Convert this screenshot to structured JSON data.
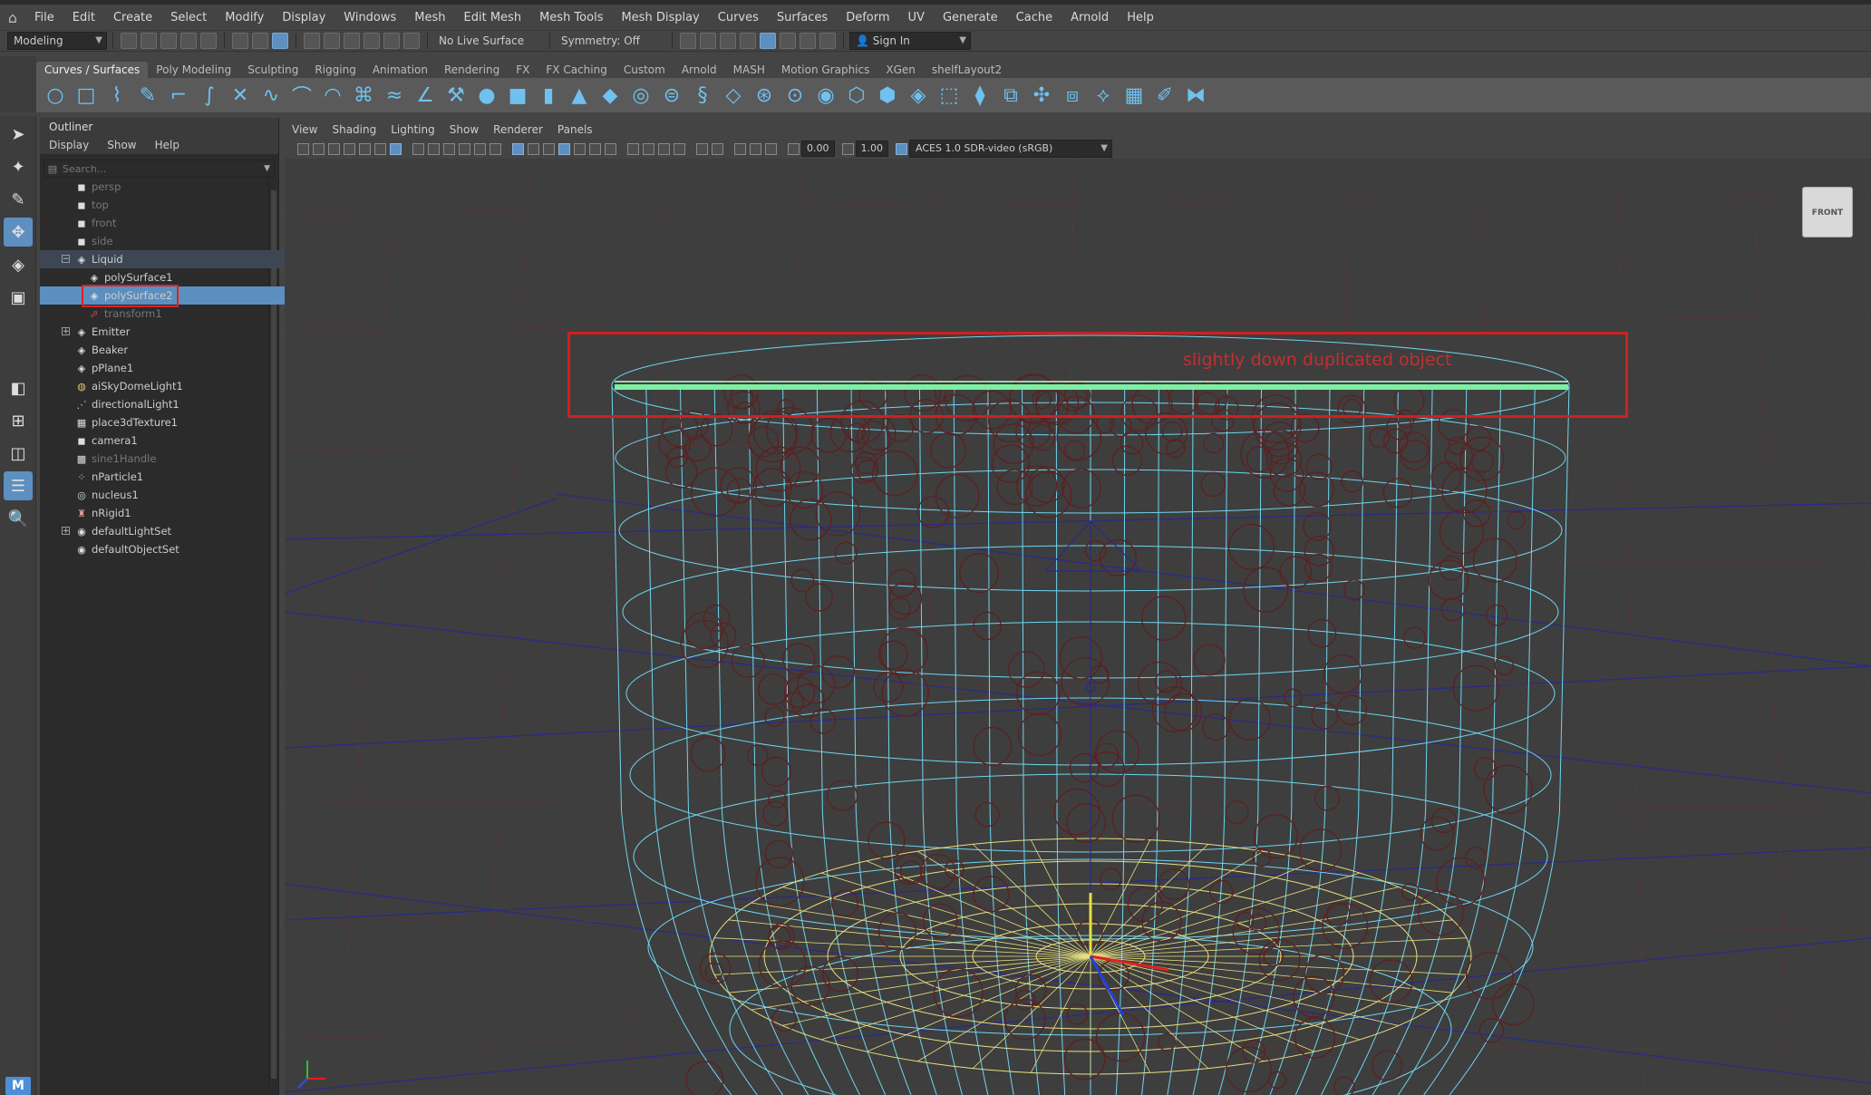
{
  "menubar": {
    "items": [
      "File",
      "Edit",
      "Create",
      "Select",
      "Modify",
      "Display",
      "Windows",
      "Mesh",
      "Edit Mesh",
      "Mesh Tools",
      "Mesh Display",
      "Curves",
      "Surfaces",
      "Deform",
      "UV",
      "Generate",
      "Cache",
      "Arnold",
      "Help"
    ]
  },
  "statusline": {
    "mode": "Modeling",
    "live_surface": "No Live Surface",
    "symmetry": "Symmetry: Off",
    "sign_in": "Sign In"
  },
  "shelf": {
    "tabs": [
      "Curves / Surfaces",
      "Poly Modeling",
      "Sculpting",
      "Rigging",
      "Animation",
      "Rendering",
      "FX",
      "FX Caching",
      "Custom",
      "Arnold",
      "MASH",
      "Motion Graphics",
      "XGen",
      "shelfLayout2"
    ],
    "active_tab": "Curves / Surfaces"
  },
  "outliner": {
    "title": "Outliner",
    "menu": [
      "Display",
      "Show",
      "Help"
    ],
    "search_placeholder": "Search...",
    "items": [
      {
        "label": "persp",
        "dim": true
      },
      {
        "label": "top",
        "dim": true
      },
      {
        "label": "front",
        "dim": true
      },
      {
        "label": "side",
        "dim": true
      },
      {
        "label": "Liquid",
        "parent": true
      },
      {
        "label": "polySurface1"
      },
      {
        "label": "polySurface2",
        "selected": true
      },
      {
        "label": "transform1",
        "dim": true
      },
      {
        "label": "Emitter"
      },
      {
        "label": "Beaker"
      },
      {
        "label": "pPlane1"
      },
      {
        "label": "aiSkyDomeLight1"
      },
      {
        "label": "directionalLight1"
      },
      {
        "label": "place3dTexture1"
      },
      {
        "label": "camera1"
      },
      {
        "label": "sine1Handle",
        "dim": true
      },
      {
        "label": "nParticle1"
      },
      {
        "label": "nucleus1"
      },
      {
        "label": "nRigid1"
      },
      {
        "label": "defaultLightSet"
      },
      {
        "label": "defaultObjectSet"
      }
    ]
  },
  "viewport": {
    "menu": [
      "View",
      "Shading",
      "Lighting",
      "Show",
      "Renderer",
      "Panels"
    ],
    "field_a": "0.00",
    "field_b": "1.00",
    "color_space": "ACES 1.0 SDR-video (sRGB)",
    "viewcube_label": "FRONT",
    "annotation": "slightly down duplicated object"
  },
  "colors": {
    "wire_cyan": "#6fd6f0",
    "wire_yellow": "#e8e080",
    "wire_green": "#7cf0a0",
    "particles": "#5a2222",
    "annotation_red": "#d02020",
    "selection_blue": "#5b8fbf"
  }
}
